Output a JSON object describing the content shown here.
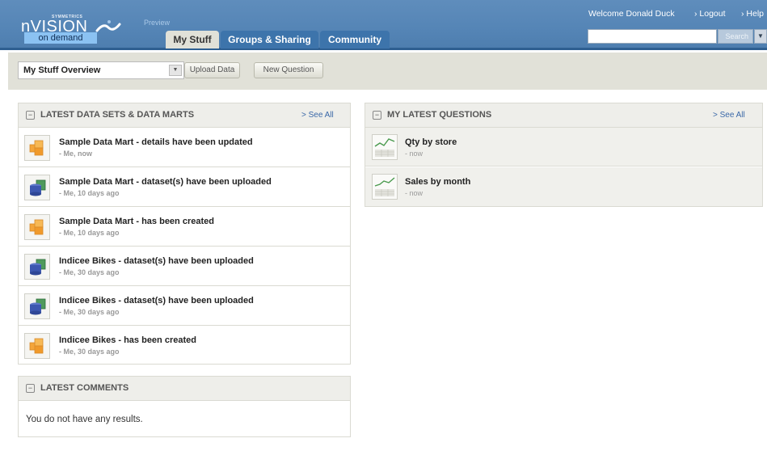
{
  "app": {
    "brand_small": "SYMMETRICS",
    "logo_text": "nVISION",
    "logo_sub": "on demand",
    "preview_label": "Preview"
  },
  "tabs": [
    {
      "label": "My Stuff",
      "active": true
    },
    {
      "label": "Groups & Sharing",
      "active": false
    },
    {
      "label": "Community",
      "active": false
    }
  ],
  "user_bar": {
    "welcome": "Welcome Donald Duck",
    "logout": "› Logout",
    "help": "› Help"
  },
  "search": {
    "placeholder": "",
    "button_label": "Search",
    "arrow": "▼"
  },
  "toolbar": {
    "view_select": "My Stuff Overview",
    "select_arrow": "▼",
    "upload_button": "Upload Data",
    "new_question_button": "New Question"
  },
  "datasets_panel": {
    "title": "LATEST DATA SETS & DATA MARTS",
    "see_all": "> See All",
    "collapse": "−",
    "items": [
      {
        "title": "Sample Data Mart - details have been updated",
        "meta": "- Me, now",
        "icon": "datamart-icon"
      },
      {
        "title": "Sample Data Mart - dataset(s) have been uploaded",
        "meta": "- Me, 10 days ago",
        "icon": "dataset-icon"
      },
      {
        "title": "Sample Data Mart - has been created",
        "meta": "- Me, 10 days ago",
        "icon": "datamart-icon"
      },
      {
        "title": "Indicee Bikes - dataset(s) have been uploaded",
        "meta": "- Me, 30 days ago",
        "icon": "dataset-icon"
      },
      {
        "title": "Indicee Bikes - dataset(s) have been uploaded",
        "meta": "- Me, 30 days ago",
        "icon": "dataset-icon"
      },
      {
        "title": "Indicee Bikes - has been created",
        "meta": "- Me, 30 days ago",
        "icon": "datamart-icon"
      }
    ]
  },
  "questions_panel": {
    "title": "MY LATEST QUESTIONS",
    "see_all": "> See All",
    "collapse": "−",
    "items": [
      {
        "title": "Qty by store",
        "meta": "- now",
        "icon": "chart-icon"
      },
      {
        "title": "Sales by month",
        "meta": "- now",
        "icon": "chart-icon"
      }
    ]
  },
  "comments_panel": {
    "title": "LATEST COMMENTS",
    "collapse": "−",
    "empty_text": "You do not have any results."
  },
  "colors": {
    "header_blue": "#5585b6",
    "tab_blue": "#3d74ab",
    "toolbar_bg": "#e1e1d8",
    "link_blue": "#3a68a8"
  }
}
